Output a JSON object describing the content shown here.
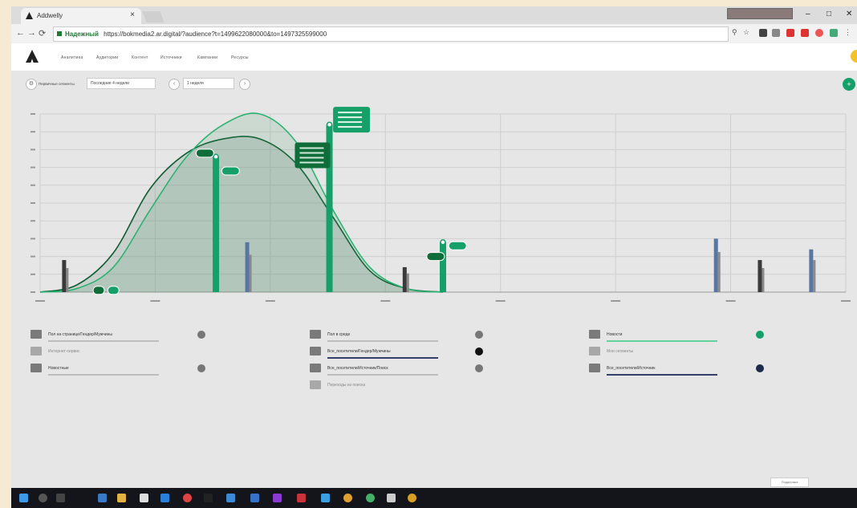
{
  "browser": {
    "tab_title": "Addwelly",
    "tab_close": "×",
    "secure_label": "Надежный",
    "url": "https://bokmedia2.ar.digital/?audience?t=1499622080000&to=1497325599000",
    "min_symbol": "–",
    "max_symbol": "□",
    "close_symbol": "✕"
  },
  "app": {
    "menu": [
      "Аналитика",
      "Аудитории",
      "Контент",
      "Источники",
      "Кампании",
      "Ресурсы"
    ]
  },
  "toolbar": {
    "segment_label": "Первичные сегменты",
    "period_select": "Последние 4 недели",
    "nav_prev": "‹",
    "nav_next": "›",
    "range_select": "1 неделя"
  },
  "chart_data": {
    "type": "line",
    "title": "",
    "xlabel": "",
    "ylabel": "",
    "ylim": [
      0,
      100
    ],
    "series": [
      {
        "values": [
          0,
          4,
          22,
          58,
          78,
          86,
          86,
          72,
          42,
          12,
          2,
          0
        ]
      },
      {
        "values": [
          0,
          2,
          14,
          46,
          76,
          94,
          100,
          84,
          46,
          14,
          2,
          0
        ]
      }
    ],
    "bars_green": [
      {
        "x": 4.8,
        "value": 76
      },
      {
        "x": 7.9,
        "value": 94
      },
      {
        "x": 11.0,
        "value": 28
      }
    ],
    "bars_blue": [
      {
        "x": 0.6,
        "value": 18
      },
      {
        "x": 5.6,
        "value": 28
      },
      {
        "x": 9.9,
        "value": 14
      },
      {
        "x": 18.4,
        "value": 30
      },
      {
        "x": 19.6,
        "value": 18
      },
      {
        "x": 21.0,
        "value": 24
      }
    ]
  },
  "legend": {
    "col1": [
      {
        "label": "Пол на странице/Гендер/Мужчины",
        "style": "dark",
        "dot": "#777777"
      },
      {
        "label": "Интернет-сервис",
        "style": "light",
        "dot": ""
      },
      {
        "label": "Новостные",
        "style": "dark",
        "dot": "#777777"
      }
    ],
    "col2": [
      {
        "label": "Пол в среде",
        "style": "dark",
        "dot": "#777777"
      },
      {
        "label": "Все_посетители/Гендер/Мужчины",
        "style": "dark",
        "dot": "#111111"
      },
      {
        "label": "Все_посетители/Источник/Поиск",
        "style": "dark",
        "dot": "#777777"
      },
      {
        "label": "Переходы из поиска",
        "style": "light",
        "dot": ""
      }
    ],
    "col3": [
      {
        "label": "Новости",
        "style": "dark",
        "dot": "#15a06a"
      },
      {
        "label": "Мои сегменты",
        "style": "light",
        "dot": ""
      },
      {
        "label": "Все_посетители/Источник",
        "style": "dark",
        "dot": "#1f2a4a"
      }
    ]
  },
  "footer": {
    "note": "Поддержка"
  },
  "colors": {
    "accent_green": "#15a06a",
    "dark_green": "#0f6d3a",
    "blue_bar": "#5876a0",
    "dark_bar": "#3a3a3a"
  }
}
